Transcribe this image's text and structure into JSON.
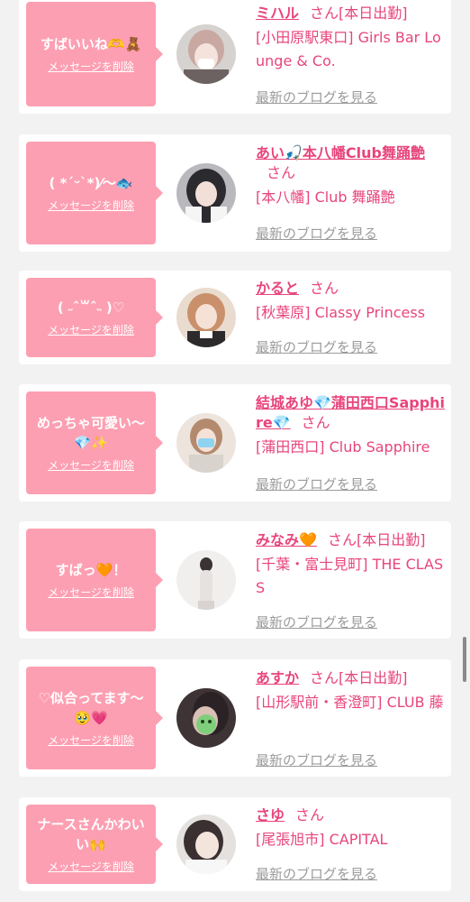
{
  "colors": {
    "bubble": "#fd9fb2",
    "accent": "#e8457b",
    "muted": "#9b9b9b",
    "background": "#f2f2f2",
    "card": "#ffffff"
  },
  "common": {
    "delete_label": "メッセージを削除",
    "blog_label": "最新のブログを見る",
    "honorific": "さん"
  },
  "cards": [
    {
      "message": "すばいいね🫶🧸",
      "name": "ミハル",
      "working": "[本日出勤]",
      "shop": "[小田原駅東口] Girls Bar Lounge & Co."
    },
    {
      "message": "( *ˊᵕˋ*)⁄〜🐟",
      "name": "あい🎣本八幡Club舞踊艶",
      "working": "",
      "shop": "[本八幡] Club 舞踊艶"
    },
    {
      "message": "( ˶ˆ꒳ˆ˵ )♡",
      "name": "かると",
      "working": "",
      "shop": "[秋葉原] Classy Princess"
    },
    {
      "message": "めっちゃ可愛い〜💎✨",
      "name": "結城あゆ💎蒲田西口Sapphire💎",
      "working": "",
      "shop": "[蒲田西口] Club Sapphire"
    },
    {
      "message": "すばっ🧡！",
      "name": "みなみ🧡",
      "working": "[本日出勤]",
      "shop": "[千葉・富士見町] THE CLASS"
    },
    {
      "message": "♡似合ってます〜🥹💗",
      "name": "あすか",
      "working": "[本日出勤]",
      "shop": "[山形駅前・香澄町] CLUB 藤"
    },
    {
      "message": "ナースさんかわいい🙌",
      "name": "さゆ",
      "working": "",
      "shop": "[尾張旭市] CAPITAL"
    }
  ]
}
